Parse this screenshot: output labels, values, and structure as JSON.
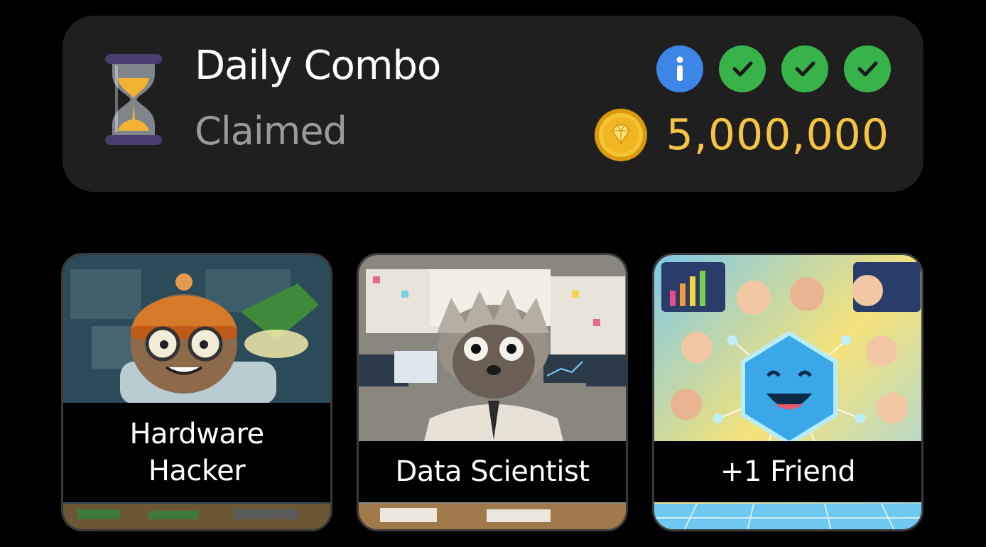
{
  "combo": {
    "title": "Daily Combo",
    "status": "Claimed",
    "reward_amount": "5,000,000",
    "info_icon": "info-icon",
    "checks": [
      "check-icon",
      "check-icon",
      "check-icon"
    ],
    "colors": {
      "panel": "#1f1f1f",
      "title": "#ffffff",
      "status": "#9a9a9a",
      "amount": "#f6c443",
      "info_badge": "#3d86e8",
      "check_badge": "#38b34a"
    }
  },
  "cards": [
    {
      "label": "Hardware\nHacker",
      "art": "sloth-hardware-hacker-image"
    },
    {
      "label": "Data Scientist",
      "art": "sloth-data-scientist-image"
    },
    {
      "label": "+1 Friend",
      "art": "friends-network-image"
    }
  ]
}
